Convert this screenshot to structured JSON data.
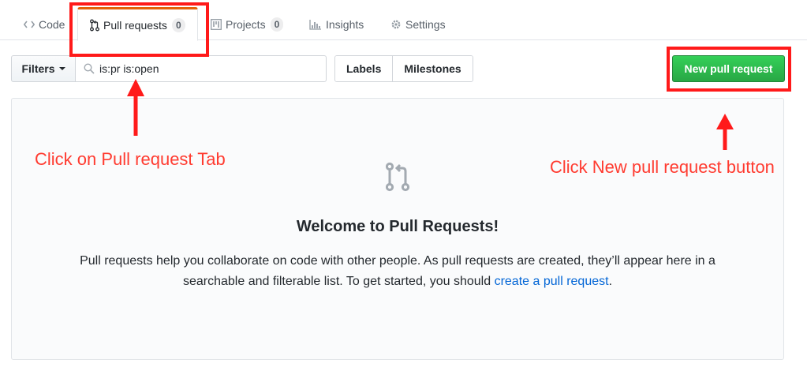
{
  "tabs": [
    {
      "label": "Code",
      "icon": "code-icon"
    },
    {
      "label": "Pull requests",
      "icon": "git-pull-request-icon",
      "count": "0",
      "selected": true
    },
    {
      "label": "Projects",
      "icon": "project-icon",
      "count": "0"
    },
    {
      "label": "Insights",
      "icon": "graph-icon"
    },
    {
      "label": "Settings",
      "icon": "gear-icon"
    }
  ],
  "toolbar": {
    "filters_label": "Filters",
    "search_value": "is:pr is:open",
    "labels_label": "Labels",
    "milestones_label": "Milestones",
    "new_pr_label": "New pull request"
  },
  "blankslate": {
    "title": "Welcome to Pull Requests!",
    "text_before": "Pull requests help you collaborate on code with other people. As pull requests are created, they’ll appear here in a searchable and filterable list. To get started, you should ",
    "link_text": "create a pull request",
    "text_after": "."
  },
  "annotations": {
    "tab_note": "Click on Pull request Tab",
    "button_note": "Click New pull request button",
    "color": "#ff3b30"
  },
  "colors": {
    "accent_tab": "#e36209",
    "primary_button": "#28a745",
    "link": "#0366d6"
  }
}
